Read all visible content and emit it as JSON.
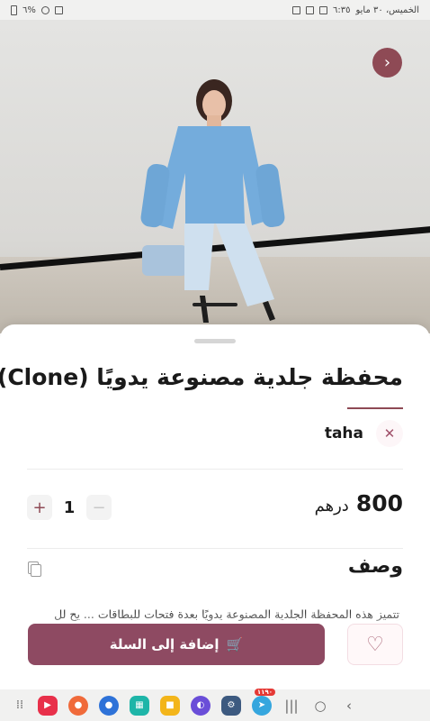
{
  "status_bar": {
    "clock": "٦:٣٥",
    "date": "الخميس، ٣٠ مايو",
    "battery": "٦%"
  },
  "product": {
    "title": "محفظة جلدية مصنوعة يدويًا (Clone)",
    "seller": "taha",
    "price_amount": "800",
    "price_currency": "درهم",
    "quantity": "1",
    "description_heading": "وصف",
    "description_text": "تتميز هذه المحفظة الجلدية المصنوعة يدويًا بعدة فتحات للبطاقات ... يح لل"
  },
  "actions": {
    "add_to_cart": "إضافة إلى السلة"
  },
  "icons": {
    "next": "chevron-right-icon",
    "copy": "copy-icon",
    "favorite": "heart-icon",
    "cart": "cart-icon"
  },
  "nav_bar": {
    "telegram_badge": "١١٩٠"
  },
  "colors": {
    "accent": "#8e4a62",
    "next_button": "#8e4a55"
  }
}
